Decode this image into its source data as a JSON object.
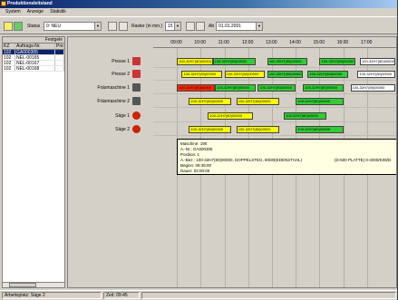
{
  "window": {
    "title": "Produktionsleitstand"
  },
  "menu": [
    "System",
    "Anzeige",
    "Statistik"
  ],
  "toolbar": {
    "status_label": "Status",
    "status_value": "0: NEU",
    "raster_label": "Raster (in min.)",
    "raster_value": "15",
    "date_label": "Ab",
    "date_value": "01.01.2001"
  },
  "order_list": {
    "header": "Festgele",
    "columns": [
      "KZ",
      "Auftrags-Nr.",
      "Prio"
    ],
    "rows": [
      {
        "kz": "102",
        "nr": "GA000305",
        "prio": "",
        "selected": true
      },
      {
        "kz": "102",
        "nr": "NEL-00165",
        "prio": ""
      },
      {
        "kz": "102",
        "nr": "NEL-00167",
        "prio": ""
      },
      {
        "kz": "102",
        "nr": "NEL-00168",
        "prio": ""
      }
    ]
  },
  "timeline": {
    "labels": [
      "09:00",
      "10:00",
      "11:00",
      "12:00",
      "13:00",
      "14:00",
      "15:00",
      "16:00",
      "17:00"
    ]
  },
  "resources": [
    {
      "name": "Presse 1",
      "icon": "press-icon"
    },
    {
      "name": "Presse 2",
      "icon": "press-icon"
    },
    {
      "name": "Fräsmaschine 1",
      "icon": "mill-icon"
    },
    {
      "name": "Fräsmaschine 2",
      "icon": "mill-icon"
    },
    {
      "name": "Säge 1",
      "icon": "saw-icon"
    },
    {
      "name": "Säge 2",
      "icon": "saw-icon"
    }
  ],
  "tasks": [
    [
      {
        "label": "100-32H7(80)00000",
        "color": "yellow",
        "start": 9.0,
        "end": 10.5
      },
      {
        "label": "100-32H7(80)00000",
        "color": "green",
        "start": 10.5,
        "end": 12.3
      },
      {
        "label": "100-32H7(80)00000",
        "color": "green",
        "start": 12.8,
        "end": 14.5
      },
      {
        "label": "100-32H7(80)00000",
        "color": "green",
        "start": 15.0,
        "end": 16.5
      },
      {
        "label": "100-32H7(80)00000",
        "color": "white",
        "start": 16.7,
        "end": 18.2
      }
    ],
    [
      {
        "label": "100-32H7(80)00000",
        "color": "yellow",
        "start": 9.2,
        "end": 10.9
      },
      {
        "label": "100-32H7(80)00000",
        "color": "yellow",
        "start": 11.0,
        "end": 12.7
      },
      {
        "label": "100-32H7(80)00000",
        "color": "green",
        "start": 12.8,
        "end": 14.3
      },
      {
        "label": "100-32H7(80)00000",
        "color": "green",
        "start": 14.5,
        "end": 16.2
      },
      {
        "label": "100-32H7(80)00000",
        "color": "white",
        "start": 16.6,
        "end": 18.2
      }
    ],
    [
      {
        "label": "100-32H7(80)00000",
        "color": "red",
        "start": 9.0,
        "end": 10.6
      },
      {
        "label": "100-32H7(80)00000",
        "color": "green",
        "start": 10.6,
        "end": 12.3
      },
      {
        "label": "100-32H7(80)00000",
        "color": "green",
        "start": 12.4,
        "end": 14.0
      },
      {
        "label": "100-32H7(80)00000",
        "color": "green",
        "start": 14.3,
        "end": 16.0
      },
      {
        "label": "100-32H7(80)00000",
        "color": "white",
        "start": 16.3,
        "end": 18.2
      }
    ],
    [
      {
        "label": "100-32H7(80)00000",
        "color": "yellow",
        "start": 9.5,
        "end": 11.3
      },
      {
        "label": "100-32H7(80)00000",
        "color": "yellow",
        "start": 11.5,
        "end": 13.3
      },
      {
        "label": "100-32H7(80)00000",
        "color": "green",
        "start": 14.0,
        "end": 16.0
      }
    ],
    [
      {
        "label": "100-32H7(80)00000",
        "color": "yellow",
        "start": 10.3,
        "end": 12.2
      },
      {
        "label": "100-32H7(80)00000",
        "color": "green",
        "start": 13.5,
        "end": 15.3
      }
    ],
    [
      {
        "label": "100-32H7(80)00000",
        "color": "yellow",
        "start": 9.5,
        "end": 11.3
      },
      {
        "label": "100-32H7(80)00000",
        "color": "yellow",
        "start": 11.5,
        "end": 13.3
      },
      {
        "label": "100-32H7(80)00000",
        "color": "green",
        "start": 14.0,
        "end": 16.0
      }
    ]
  ],
  "tooltip": {
    "lines": [
      "Maschine: 190",
      "A.-Nr.: GA000305",
      "Position: 1",
      "A.-Bez.: 100-32H7(80)00000, DOPPELSTEG, 80/80(EDENSTAHL)",
      "Beginn: 09:45:00",
      "Dauer: 02:00:00"
    ],
    "extra": "(D-500 PLATTE) 0-4000/K08/D"
  },
  "statusbar": {
    "left": "Arbeitsplatz: Säge 2",
    "time": "Zeit: 09:45"
  }
}
